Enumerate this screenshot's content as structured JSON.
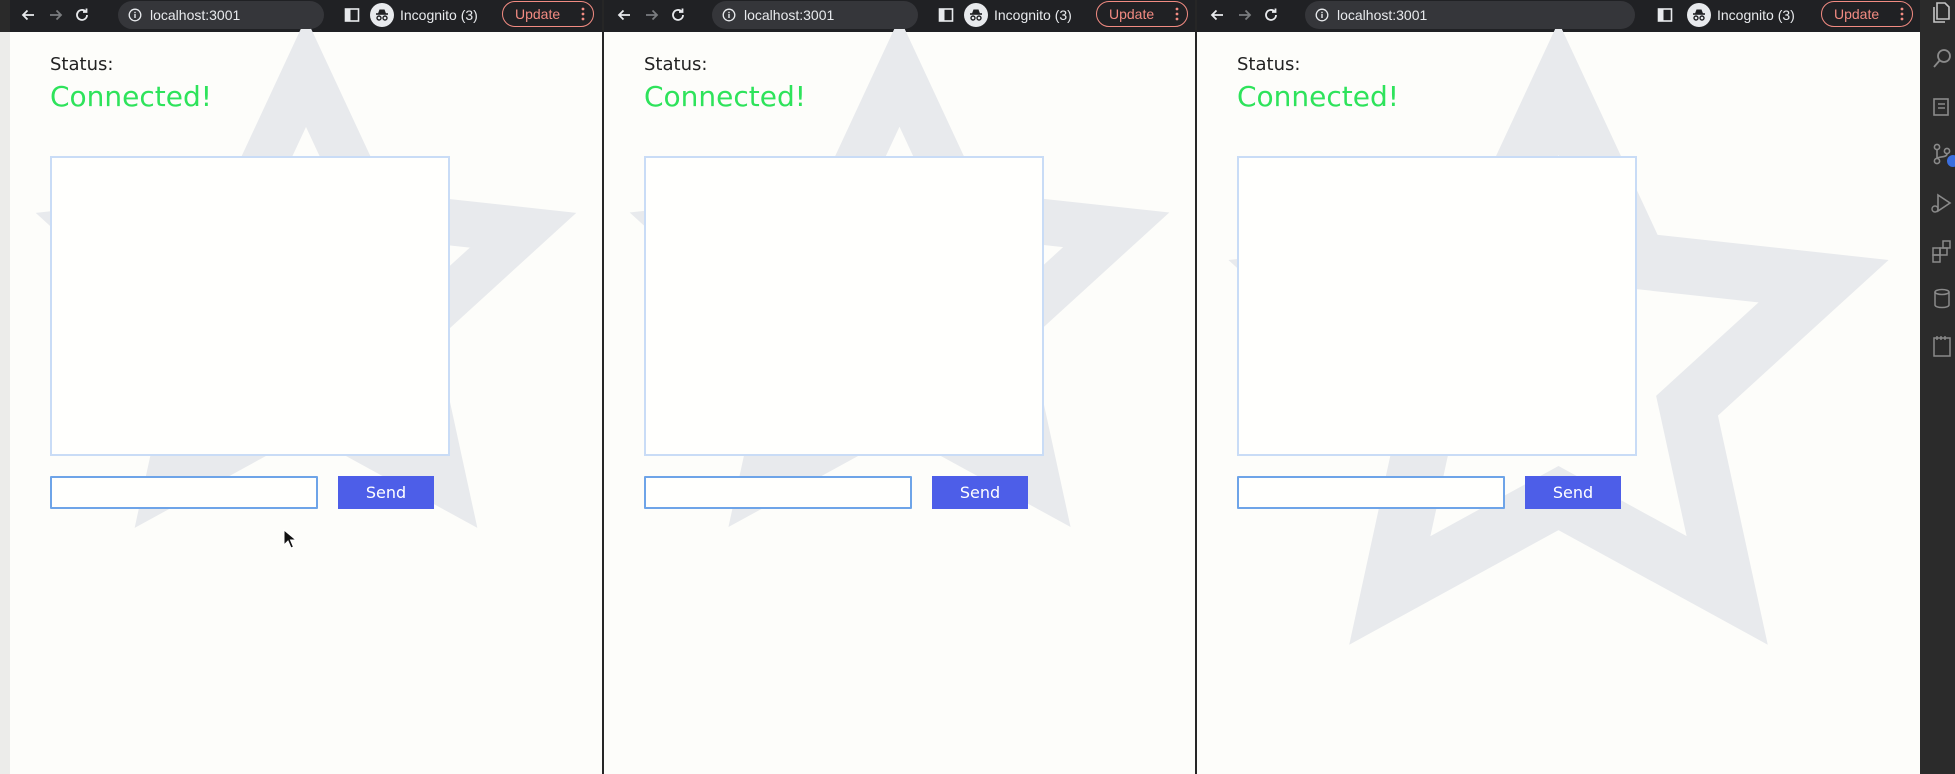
{
  "browser": {
    "url": "localhost:3001",
    "profile_label": "Incognito (3)",
    "update_label": "Update"
  },
  "page": {
    "status_label": "Status:",
    "status_value": "Connected!",
    "message_input_value": "",
    "send_label": "Send"
  },
  "colors": {
    "status_connected": "#2ee35b",
    "send_button": "#4d5ee8",
    "chrome_toolbar": "#202124",
    "update_outline": "#f28b82"
  },
  "icons": [
    "back-arrow-icon",
    "forward-arrow-icon",
    "reload-icon",
    "info-icon",
    "star-icon",
    "side-panel-icon",
    "incognito-icon",
    "kebab-menu-icon",
    "mouse-cursor-icon",
    "explorer-icon",
    "search-icon",
    "source-control-icon",
    "run-debug-icon",
    "extensions-icon",
    "database-icon",
    "notebook-icon"
  ]
}
